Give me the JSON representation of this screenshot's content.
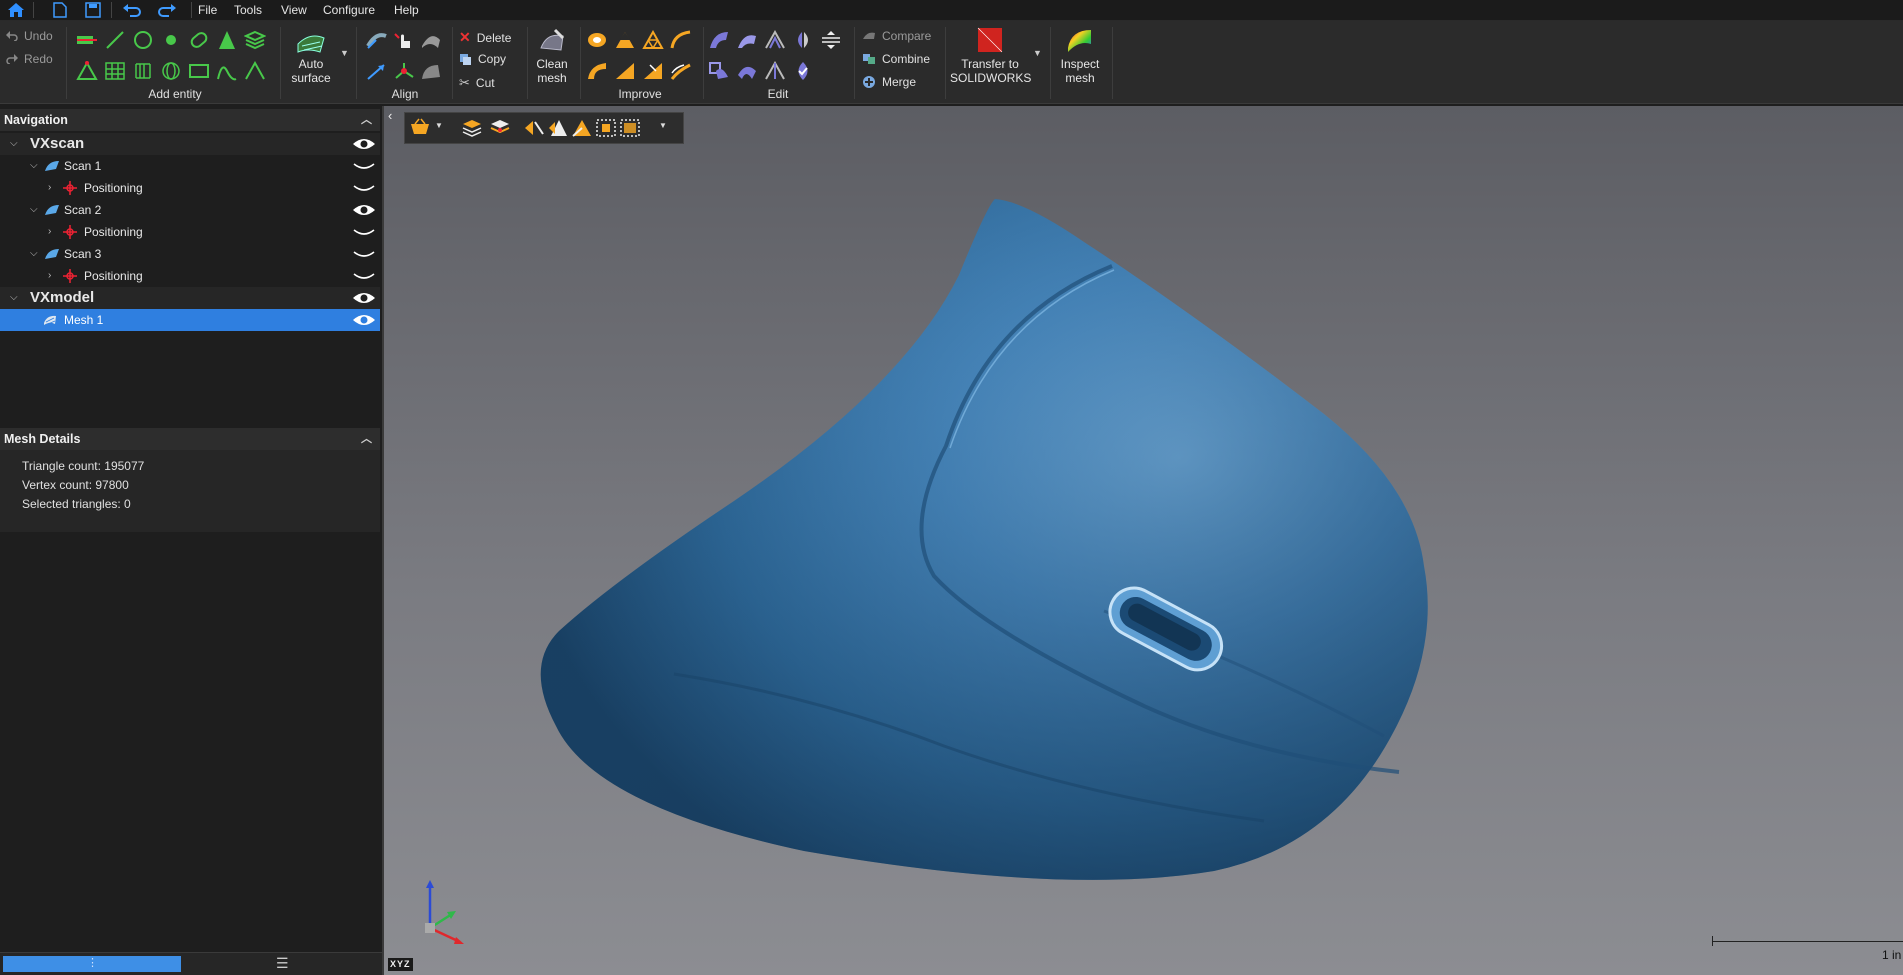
{
  "menu": {
    "items": [
      "File",
      "Tools",
      "View",
      "Configure",
      "Help"
    ]
  },
  "ribbon": {
    "undo_label": "Undo",
    "redo_label": "Redo",
    "add_entity_label": "Add entity",
    "auto_surface_line1": "Auto",
    "auto_surface_line2": "surface",
    "align_label": "Align",
    "delete_label": "Delete",
    "copy_label": "Copy",
    "cut_label": "Cut",
    "clean_mesh_line1": "Clean",
    "clean_mesh_line2": "mesh",
    "improve_label": "Improve",
    "edit_label": "Edit",
    "compare_label": "Compare",
    "combine_label": "Combine",
    "merge_label": "Merge",
    "transfer_line1": "Transfer to",
    "transfer_line2": "SOLIDWORKS",
    "inspect_line1": "Inspect",
    "inspect_line2": "mesh"
  },
  "navigation": {
    "title": "Navigation",
    "rows": [
      {
        "label": "VXscan"
      },
      {
        "label": "Scan 1"
      },
      {
        "label": "Positioning"
      },
      {
        "label": "Scan 2"
      },
      {
        "label": "Positioning"
      },
      {
        "label": "Scan 3"
      },
      {
        "label": "Positioning"
      },
      {
        "label": "VXmodel"
      },
      {
        "label": "Mesh 1"
      }
    ]
  },
  "mesh_details": {
    "title": "Mesh Details",
    "triangle_count": "Triangle count: 195077",
    "vertex_count": "Vertex count: 97800",
    "selected_triangles": "Selected triangles: 0"
  },
  "viewport": {
    "axis_label": "XYZ",
    "scale_label": "1 in",
    "model_color": "#3f7fb5"
  },
  "colors": {
    "accent": "#2f7fe0",
    "ribbon_bg": "#2b2b2b",
    "panel_bg": "#1e1e1e",
    "solidworks_red": "#d0241f"
  }
}
